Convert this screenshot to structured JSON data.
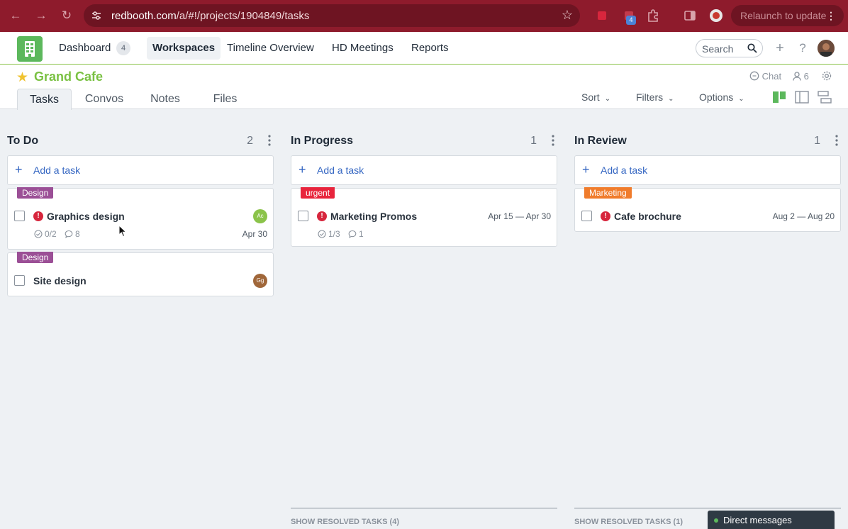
{
  "browser": {
    "url_host": "redbooth.com",
    "url_path": "/a/#!/projects/1904849/tasks",
    "relaunch_label": "Relaunch to update",
    "extension_badge": "4"
  },
  "topnav": {
    "items": [
      {
        "label": "Dashboard"
      },
      {
        "label": "Workspaces"
      },
      {
        "label": "Timeline Overview"
      },
      {
        "label": "HD Meetings"
      },
      {
        "label": "Reports"
      }
    ],
    "dashboard_count": "4",
    "search_placeholder": "Search"
  },
  "project": {
    "title": "Grand Cafe",
    "chat_label": "Chat",
    "members_count": "6",
    "tabs": [
      {
        "label": "Tasks"
      },
      {
        "label": "Convos"
      },
      {
        "label": "Notes"
      },
      {
        "label": "Files"
      }
    ],
    "controls": {
      "sort": "Sort",
      "filters": "Filters",
      "options": "Options"
    }
  },
  "columns": [
    {
      "title": "To Do",
      "count": "2",
      "add_label": "Add a task",
      "cards": [
        {
          "tag": "Design",
          "tag_color": "#9b4f96",
          "title": "Graphics design",
          "urgent": true,
          "checklist": "0/2",
          "comments": "8",
          "date": "Apr 30",
          "assignee": "Ac",
          "assignee_color": "#8bc34a"
        },
        {
          "tag": "Design",
          "tag_color": "#9b4f96",
          "title": "Site design",
          "urgent": false,
          "assignee": "Gg",
          "assignee_color": "#a0673a"
        }
      ]
    },
    {
      "title": "In Progress",
      "count": "1",
      "add_label": "Add a task",
      "cards": [
        {
          "tag": "urgent",
          "tag_color": "#e8243c",
          "title": "Marketing Promos",
          "urgent": true,
          "checklist": "1/3",
          "comments": "1",
          "date": "Apr 15 — Apr 30"
        }
      ],
      "resolved_label": "SHOW RESOLVED TASKS (4)"
    },
    {
      "title": "In Review",
      "count": "1",
      "add_label": "Add a task",
      "cards": [
        {
          "tag": "Marketing",
          "tag_color": "#f07c2c",
          "title": "Cafe brochure",
          "urgent": true,
          "date": "Aug 2 — Aug 20"
        }
      ],
      "resolved_label": "SHOW RESOLVED TASKS (1)"
    }
  ],
  "direct_messages": {
    "label": "Direct messages"
  }
}
